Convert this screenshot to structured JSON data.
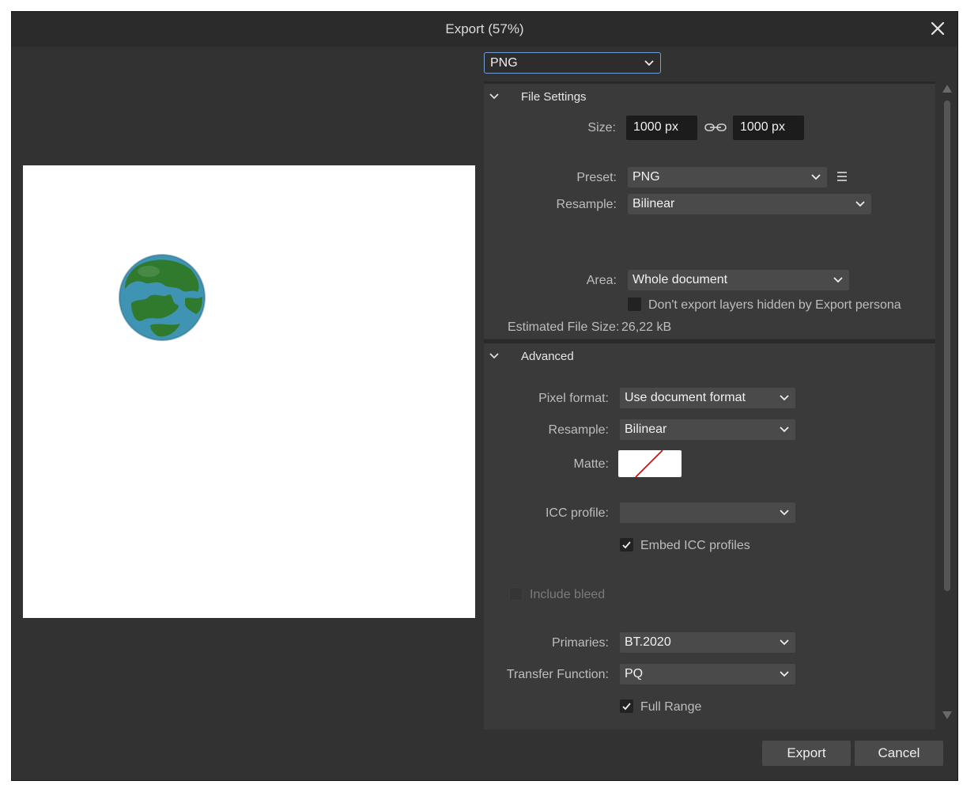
{
  "dialog": {
    "title": "Export (57%)"
  },
  "format_select": {
    "value": "PNG"
  },
  "file_settings": {
    "header": "File Settings",
    "size_label": "Size:",
    "width": "1000 px",
    "height": "1000 px",
    "preset_label": "Preset:",
    "preset": "PNG",
    "resample_label": "Resample:",
    "resample": "Bilinear",
    "area_label": "Area:",
    "area": "Whole document",
    "hidden_layers_label": "Don't export layers hidden by Export persona",
    "hidden_layers_checked": false,
    "estimated_size_label": "Estimated File Size:",
    "estimated_size": "26,22 kB"
  },
  "advanced": {
    "header": "Advanced",
    "pixel_format_label": "Pixel format:",
    "pixel_format": "Use document format",
    "resample_label": "Resample:",
    "resample": "Bilinear",
    "matte_label": "Matte:",
    "icc_label": "ICC profile:",
    "icc_profile": "",
    "embed_icc_label": "Embed ICC profiles",
    "embed_icc_checked": true,
    "include_bleed_label": "Include bleed",
    "include_bleed_checked": false,
    "primaries_label": "Primaries:",
    "primaries": "BT.2020",
    "transfer_label": "Transfer Function:",
    "transfer": "PQ",
    "full_range_label": "Full Range",
    "full_range_checked": true
  },
  "buttons": {
    "export": "Export",
    "cancel": "Cancel"
  },
  "icons": {
    "close": "close-icon",
    "link": "link-icon",
    "menu": "hamburger-menu-icon",
    "chevron": "chevron-down-icon"
  },
  "colors": {
    "dialog_bg": "#323232",
    "panel_bg": "#3a3a3a",
    "accent_border": "#6f9fd4",
    "matte_slash": "#d40000"
  }
}
